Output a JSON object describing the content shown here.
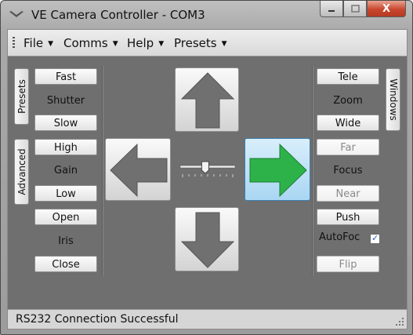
{
  "window": {
    "title": "VE Camera Controller - COM3",
    "minimize_icon": "minimize-icon",
    "maximize_icon": "maximize-icon",
    "close_label": "X"
  },
  "menu": [
    {
      "label": "File"
    },
    {
      "label": "Comms"
    },
    {
      "label": "Help"
    },
    {
      "label": "Presets"
    }
  ],
  "left_tabs": {
    "presets": "Presets",
    "advanced": "Advanced"
  },
  "right_tabs": {
    "windows": "Windows"
  },
  "left_panel": {
    "shutter": {
      "fast": "Fast",
      "label": "Shutter",
      "slow": "Slow"
    },
    "gain": {
      "high": "High",
      "label": "Gain",
      "low": "Low"
    },
    "iris": {
      "open": "Open",
      "label": "Iris",
      "close": "Close"
    }
  },
  "right_panel": {
    "zoom": {
      "tele": "Tele",
      "label": "Zoom",
      "wide": "Wide"
    },
    "focus": {
      "far": "Far",
      "label": "Focus",
      "near": "Near"
    },
    "push": "Push",
    "autofocus": {
      "label": "AutoFoc",
      "checked": true
    },
    "flip": "Flip"
  },
  "pan_tilt": {
    "active_direction": "right",
    "speed_slider": 0.45
  },
  "status": {
    "text": "RS232 Connection Successful"
  },
  "colors": {
    "active_arrow": "#2db24a",
    "active_button_bg": "#aad6f3",
    "arrow_gray": "#6f6f6f"
  }
}
